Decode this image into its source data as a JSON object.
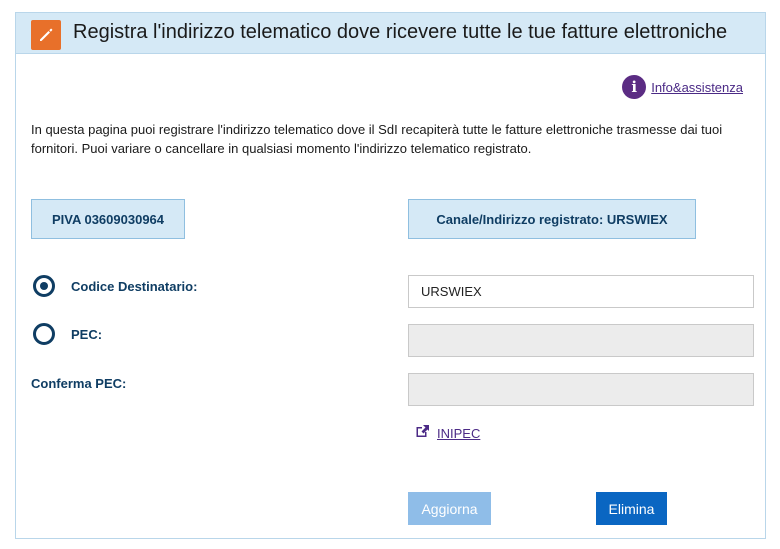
{
  "header": {
    "title": "Registra l'indirizzo telematico dove ricevere tutte le tue fatture elettroniche",
    "icon": "pencil-icon",
    "icon_bg": "#e8702a"
  },
  "info": {
    "icon": "info-icon",
    "link_text": "Info&assistenza"
  },
  "intro_text": "In questa pagina puoi registrare l'indirizzo telematico dove il SdI recapiterà tutte le fatture elettroniche trasmesse dai tuoi fornitori. Puoi variare o cancellare in qualsiasi momento l'indirizzo telematico registrato.",
  "piva_box": "PIVA 03609030964",
  "canale_box": "Canale/Indirizzo registrato: URSWIEX",
  "form": {
    "codice_destinatario": {
      "label": "Codice Destinatario:",
      "checked": true,
      "value": "URSWIEX"
    },
    "pec": {
      "label": "PEC:",
      "checked": false,
      "value": ""
    },
    "conferma_pec": {
      "label": "Conferma PEC:",
      "value": ""
    }
  },
  "inipec": {
    "icon": "external-link-icon",
    "link_text": "INIPEC"
  },
  "buttons": {
    "aggiorna": "Aggiorna",
    "elimina": "Elimina"
  },
  "colors": {
    "header_bg": "#d5e9f6",
    "label_color": "#0f3d63",
    "link_color": "#4b2a86",
    "primary_button": "#0a66c2",
    "disabled_button": "#8fbde8"
  }
}
